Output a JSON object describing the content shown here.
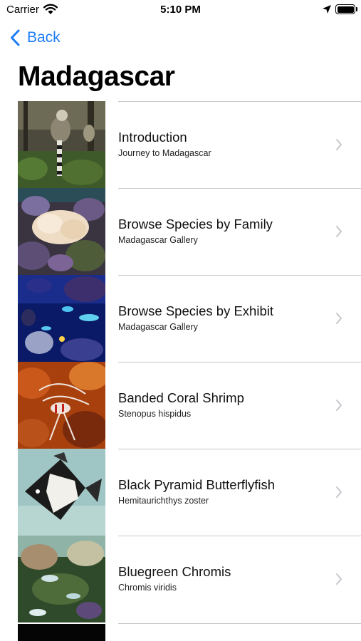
{
  "status_bar": {
    "carrier": "Carrier",
    "time": "5:10 PM",
    "icons": [
      "wifi-icon",
      "location-arrow-icon",
      "battery-icon"
    ],
    "battery_level": 1.0
  },
  "nav": {
    "back_label": "Back",
    "title": "Madagascar"
  },
  "colors": {
    "accent": "#1e7cf6",
    "separator": "#c8c7cc",
    "chevron": "#c7c7cc"
  },
  "items": [
    {
      "title": "Introduction",
      "subtitle": "Journey to Madagascar",
      "thumb": "lemurs-photo"
    },
    {
      "title": "Browse Species by Family",
      "subtitle": "Madagascar Gallery",
      "thumb": "coral-photo"
    },
    {
      "title": "Browse Species by Exhibit",
      "subtitle": "Madagascar Gallery",
      "thumb": "reef-tank-photo"
    },
    {
      "title": "Banded Coral Shrimp",
      "subtitle": "Stenopus hispidus",
      "thumb": "shrimp-photo"
    },
    {
      "title": "Black Pyramid Butterflyfish",
      "subtitle": "Hemitaurichthys zoster",
      "thumb": "butterflyfish-photo"
    },
    {
      "title": "Bluegreen Chromis",
      "subtitle": "Chromis viridis",
      "thumb": "chromis-photo"
    }
  ]
}
